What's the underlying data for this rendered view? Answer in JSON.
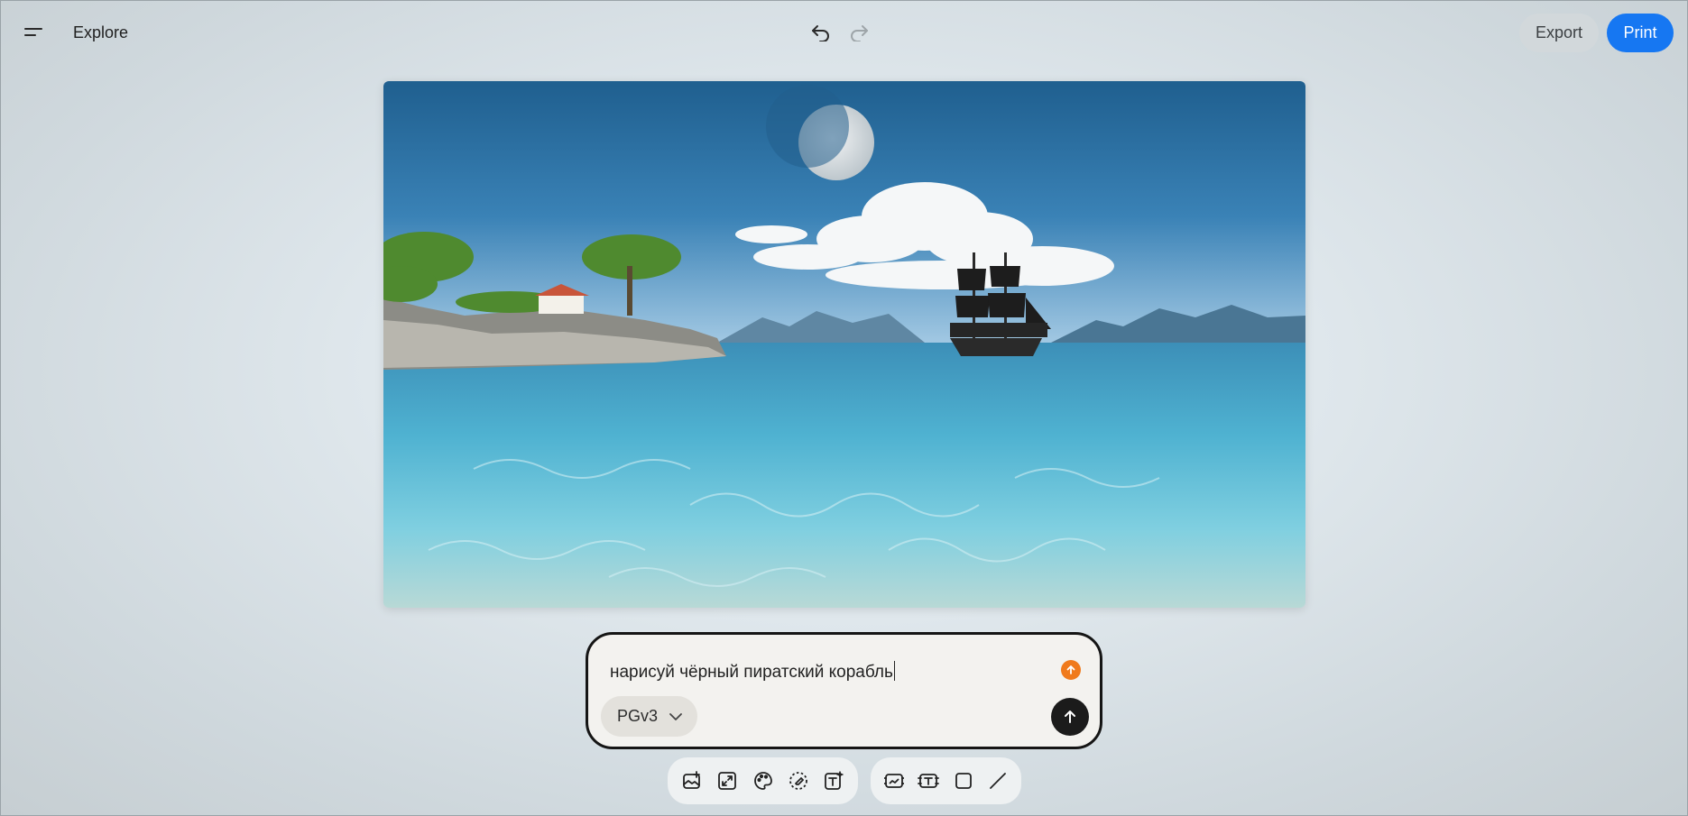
{
  "header": {
    "title": "Explore",
    "menu_icon": "menu-icon",
    "undo_icon": "undo-icon",
    "redo_icon": "redo-icon",
    "export_label": "Export",
    "print_label": "Print"
  },
  "canvas": {
    "image_subject": "pirate ship on clear sea near rocky island with moon"
  },
  "prompt": {
    "text": "нарисуй чёрный пиратский корабль",
    "model": "PGv3",
    "upload_icon": "upload-arrow-icon",
    "send_icon": "send-arrow-icon"
  },
  "toolbar": {
    "group1": [
      "add-image-icon",
      "expand-icon",
      "palette-icon",
      "eraser-icon",
      "add-text-icon"
    ],
    "group2": [
      "image-frame-icon",
      "text-frame-icon",
      "rectangle-icon",
      "line-icon"
    ]
  },
  "colors": {
    "print_button": "#1677f2",
    "export_button": "#d2d8db",
    "upload_badge": "#f07a1c",
    "send_button": "#1b1b1b"
  }
}
